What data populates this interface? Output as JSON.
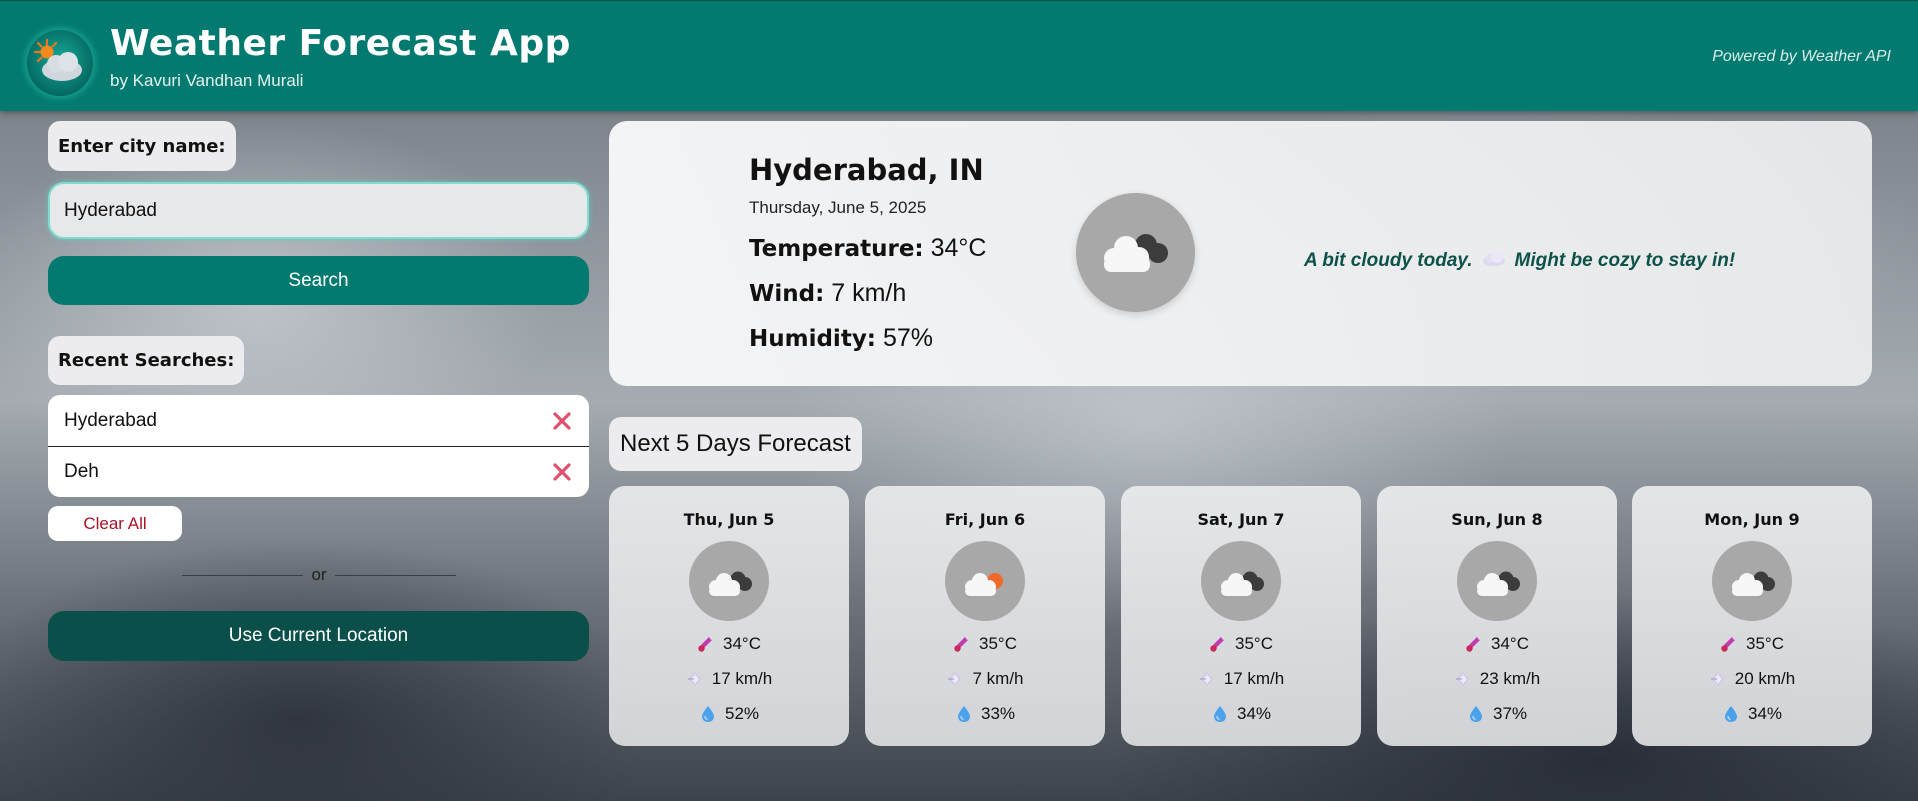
{
  "header": {
    "title": "Weather Forecast App",
    "subtitle": "by Kavuri Vandhan Murali",
    "powered_by": "Powered by Weather API",
    "logo_icon": "sun-cloud-icon",
    "background_color": "#037a70"
  },
  "search": {
    "label": "Enter city name:",
    "value": "Hyderabad",
    "button_label": "Search"
  },
  "recent": {
    "label": "Recent Searches:",
    "items": [
      {
        "city": "Hyderabad"
      },
      {
        "city": "Deh"
      }
    ],
    "clear_label": "Clear All"
  },
  "divider_text": "or",
  "location_button": "Use Current Location",
  "current": {
    "city": "Hyderabad, IN",
    "date": "Thursday, June 5, 2025",
    "temperature_label": "Temperature:",
    "temperature": "34°C",
    "wind_label": "Wind:",
    "wind": "7 km/h",
    "humidity_label": "Humidity:",
    "humidity": "57%",
    "icon": "cloudy-icon",
    "message": "A bit cloudy today. ☁️ Might be cozy to stay in!",
    "message_before": "A bit cloudy today.",
    "message_after": "Might be cozy to stay in!"
  },
  "forecast": {
    "title": "Next 5 Days Forecast",
    "days": [
      {
        "day": "Thu, Jun 5",
        "temp": "34°C",
        "wind": "17 km/h",
        "humidity": "52%",
        "icon": "broken-clouds-icon"
      },
      {
        "day": "Fri, Jun 6",
        "temp": "35°C",
        "wind": "7 km/h",
        "humidity": "33%",
        "icon": "partly-cloudy-icon"
      },
      {
        "day": "Sat, Jun 7",
        "temp": "35°C",
        "wind": "17 km/h",
        "humidity": "34%",
        "icon": "broken-clouds-icon"
      },
      {
        "day": "Sun, Jun 8",
        "temp": "34°C",
        "wind": "23 km/h",
        "humidity": "37%",
        "icon": "broken-clouds-icon"
      },
      {
        "day": "Mon, Jun 9",
        "temp": "35°C",
        "wind": "20 km/h",
        "humidity": "34%",
        "icon": "broken-clouds-icon"
      }
    ]
  },
  "colors": {
    "accent": "#037a70",
    "dark_accent": "#0a4f49",
    "remove_x": "#e0506e",
    "clear_text": "#a51426",
    "message_text": "#0d5248"
  }
}
